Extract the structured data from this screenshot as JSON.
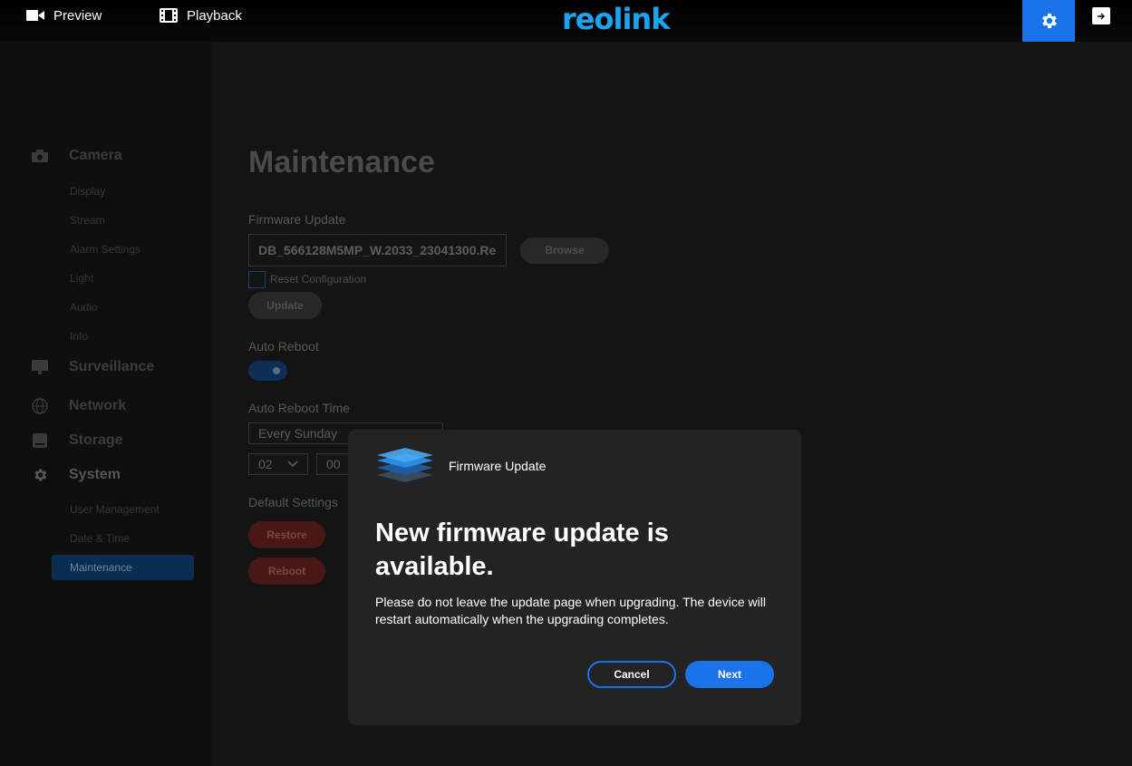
{
  "topbar": {
    "preview_label": "Preview",
    "playback_label": "Playback",
    "logo_text": "reolink",
    "accent_color": "#1a73e8"
  },
  "sidebar": {
    "categories": [
      {
        "label": "Camera",
        "icon": "camera-icon"
      },
      {
        "label": "Surveillance",
        "icon": "monitor-icon"
      },
      {
        "label": "Network",
        "icon": "globe-icon"
      },
      {
        "label": "Storage",
        "icon": "storage-icon"
      },
      {
        "label": "System",
        "icon": "gear-icon"
      }
    ],
    "camera_items": [
      "Display",
      "Stream",
      "Alarm Settings",
      "Light",
      "Audio",
      "Info"
    ],
    "system_items": [
      "User Management",
      "Date & Time",
      "Maintenance"
    ],
    "active_item": "Maintenance"
  },
  "main": {
    "title": "Maintenance",
    "firmware_label": "Firmware Update",
    "firmware_file": "DB_566128M5MP_W.2033_23041300.Re",
    "browse_label": "Browse",
    "reset_label": "Reset Configuration",
    "update_label": "Update",
    "auto_reboot_label": "Auto Reboot",
    "auto_reboot_time_label": "Auto Reboot Time",
    "reboot_day": "Every Sunday",
    "reboot_hour": "02",
    "reboot_minute": "00",
    "default_settings_label": "Default Settings",
    "restore_label": "Restore",
    "reboot_label": "Reboot"
  },
  "modal": {
    "header_title": "Firmware Update",
    "heading": "New firmware update is available.",
    "message": "Please do not leave the update page when upgrading. The device will restart automatically when the upgrading completes.",
    "cancel_label": "Cancel",
    "next_label": "Next"
  }
}
